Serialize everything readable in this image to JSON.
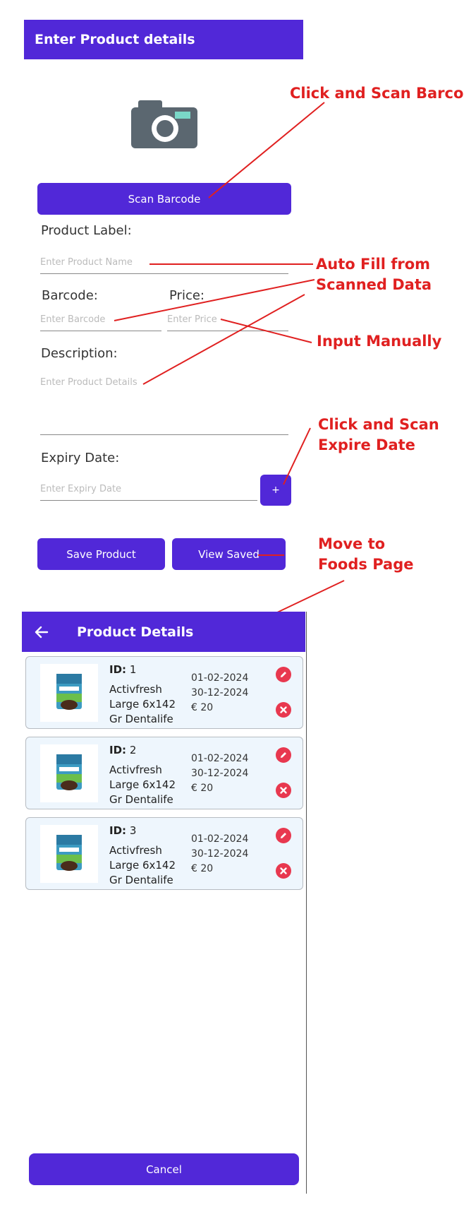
{
  "form": {
    "title": "Enter Product details",
    "scan_button": "Scan Barcode",
    "product_label": "Product Label:",
    "product_placeholder": "Enter Product Name",
    "barcode_label": "Barcode:",
    "barcode_placeholder": "Enter Barcode",
    "price_label": "Price:",
    "price_placeholder": "Enter Price",
    "description_label": "Description:",
    "description_placeholder": "Enter Product Details",
    "expiry_label": "Expiry Date:",
    "expiry_placeholder": "Enter Expiry Date",
    "expiry_add": "+",
    "save_button": "Save Product",
    "view_button": "View Saved"
  },
  "annotations": {
    "scan": "Click and Scan Barcode",
    "autofill_line1": "Auto Fill from",
    "autofill_line2": "Scanned Data",
    "manual": "Input Manually",
    "expire_line1": "Click and Scan",
    "expire_line2": "Expire Date",
    "foods_line1": "Move to",
    "foods_line2": "Foods Page"
  },
  "details": {
    "title": "Product Details",
    "cancel_button": "Cancel",
    "id_prefix": "ID:",
    "products": [
      {
        "id": "1",
        "name_line1": "Activfresh",
        "name_line2": "Large 6x142",
        "name_line3": "Gr Dentalife",
        "date1": "01-02-2024",
        "date2": "30-12-2024",
        "price": "€ 20"
      },
      {
        "id": "2",
        "name_line1": "Activfresh",
        "name_line2": "Large 6x142",
        "name_line3": "Gr Dentalife",
        "date1": "01-02-2024",
        "date2": "30-12-2024",
        "price": "€ 20"
      },
      {
        "id": "3",
        "name_line1": "Activfresh",
        "name_line2": "Large 6x142",
        "name_line3": "Gr Dentalife",
        "date1": "01-02-2024",
        "date2": "30-12-2024",
        "price": "€ 20"
      }
    ]
  },
  "colors": {
    "accent": "#5128d8",
    "annotation": "#e02020",
    "icon_red": "#e8384f",
    "card_bg": "#eef6fd"
  },
  "icons": [
    "camera-icon",
    "back-arrow-icon",
    "edit-icon",
    "delete-icon"
  ]
}
